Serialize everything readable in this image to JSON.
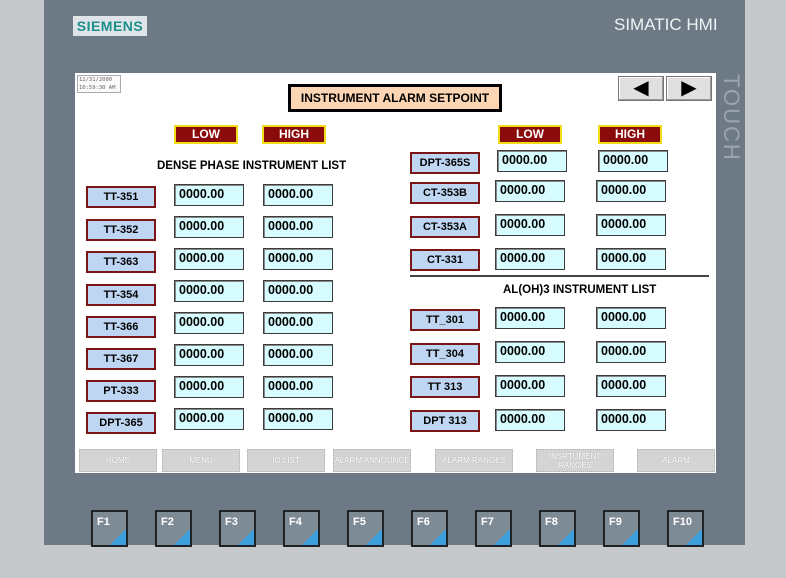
{
  "device": {
    "brand": "SIEMENS",
    "model": "SIMATIC HMI",
    "side_label": "TOUCH"
  },
  "clock": {
    "date": "12/31/2000",
    "time": "10:59:30 AM"
  },
  "title": "INSTRUMENT ALARM SETPOINT",
  "nav": {
    "back_label": "◀",
    "forward_label": "▶"
  },
  "headers": {
    "low": "LOW",
    "high": "HIGH"
  },
  "dense_phase": {
    "title": "DENSE PHASE INSTRUMENT LIST",
    "rows": [
      {
        "tag": "TT-351",
        "low": "0000.00",
        "high": "0000.00"
      },
      {
        "tag": "TT-352",
        "low": "0000.00",
        "high": "0000.00"
      },
      {
        "tag": "TT-363",
        "low": "0000.00",
        "high": "0000.00"
      },
      {
        "tag": "TT-354",
        "low": "0000.00",
        "high": "0000.00"
      },
      {
        "tag": "TT-366",
        "low": "0000.00",
        "high": "0000.00"
      },
      {
        "tag": "TT-367",
        "low": "0000.00",
        "high": "0000.00"
      },
      {
        "tag": "PT-333",
        "low": "0000.00",
        "high": "0000.00"
      },
      {
        "tag": "DPT-365",
        "low": "0000.00",
        "high": "0000.00"
      }
    ]
  },
  "right_top": {
    "rows": [
      {
        "tag": "DPT-365S",
        "low": "0000.00",
        "high": "0000.00"
      },
      {
        "tag": "CT-353B",
        "low": "0000.00",
        "high": "0000.00"
      },
      {
        "tag": "CT-353A",
        "low": "0000.00",
        "high": "0000.00"
      },
      {
        "tag": "CT-331",
        "low": "0000.00",
        "high": "0000.00"
      }
    ]
  },
  "aloh3": {
    "title": "AL(OH)3 INSTRUMENT LIST",
    "rows": [
      {
        "tag": "TT_301",
        "low": "0000.00",
        "high": "0000.00"
      },
      {
        "tag": "TT_304",
        "low": "0000.00",
        "high": "0000.00"
      },
      {
        "tag": "TT 313",
        "low": "0000.00",
        "high": "0000.00"
      },
      {
        "tag": "DPT 313",
        "low": "0000.00",
        "high": "0000.00"
      }
    ]
  },
  "footer": [
    "HOME",
    "MENU",
    "IO LIST",
    "ALARM ANNOUNCE",
    "ALARM RANGES",
    "INSRTUMENT RANGES",
    "ALARM"
  ],
  "fkeys": [
    "F1",
    "F2",
    "F3",
    "F4",
    "F5",
    "F6",
    "F7",
    "F8",
    "F9",
    "F10"
  ],
  "colors": {
    "tag_fill": "#bfd6f2",
    "tag_border": "#7a1515",
    "value_fill": "#d6fcff",
    "header_fill": "#8b0b0b",
    "header_border": "#f2dc1a",
    "title_fill": "#fcd5b4",
    "bezel": "#6d7a85",
    "fkey_accent": "#3da0dc"
  }
}
